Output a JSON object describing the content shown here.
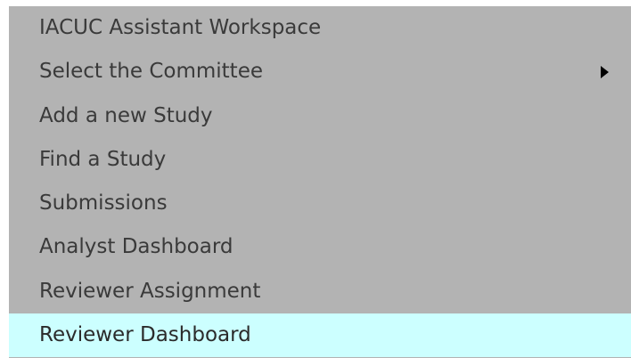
{
  "menu": {
    "items": [
      {
        "label": "IACUC Assistant Workspace"
      },
      {
        "label": "Select the Committee"
      },
      {
        "label": "Add a new Study"
      },
      {
        "label": "Find a Study"
      },
      {
        "label": "Submissions"
      },
      {
        "label": "Analyst Dashboard"
      },
      {
        "label": "Reviewer Assignment"
      },
      {
        "label": "Reviewer Dashboard"
      }
    ],
    "selected_item": "Reviewer Dashboard",
    "submenu_icon": "triangle-right-icon"
  },
  "colors": {
    "menu_background": "#b3b3b3",
    "selected_background": "#ccffff",
    "text": "#3a3a3a"
  }
}
